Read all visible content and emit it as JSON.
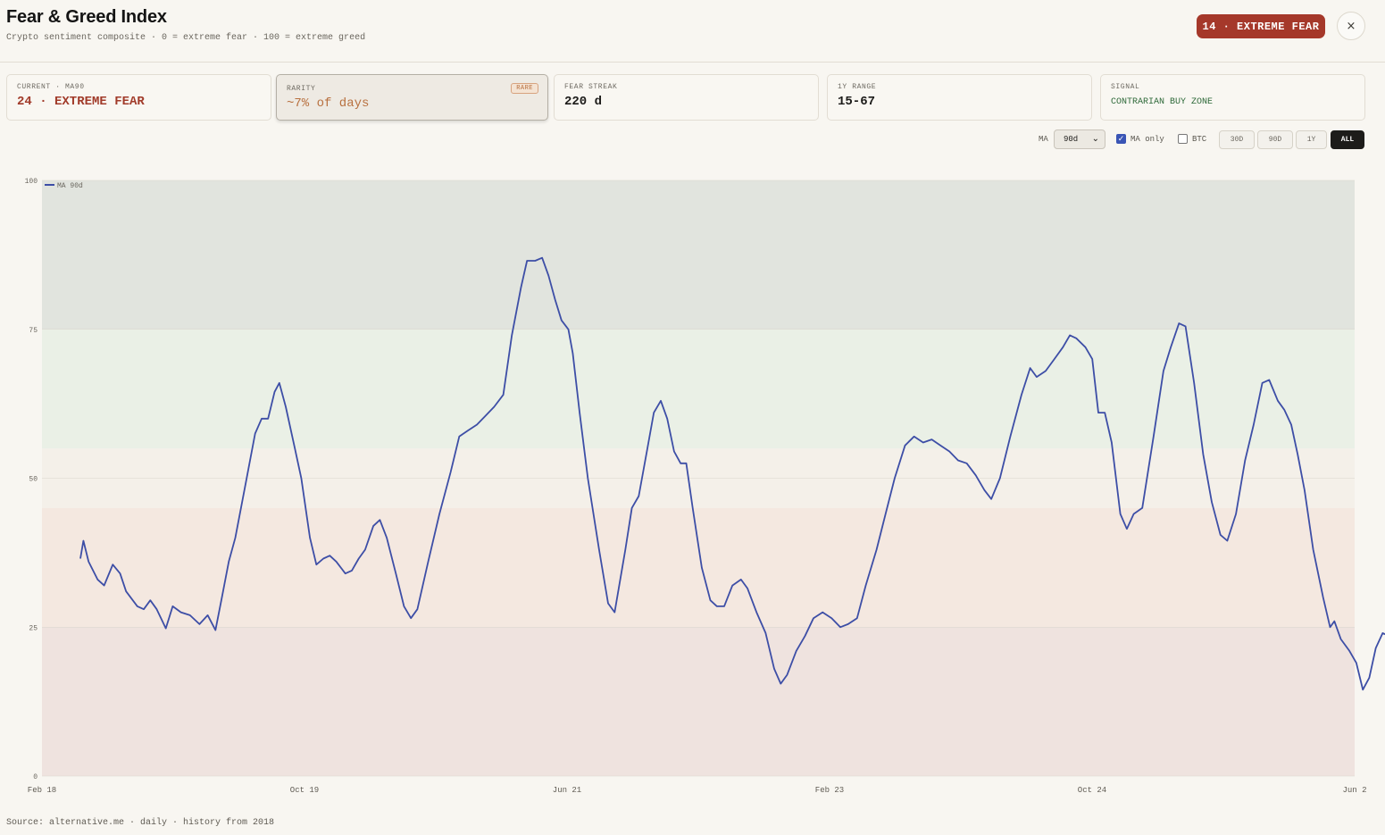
{
  "header": {
    "title": "Fear & Greed Index",
    "subtitle": "Crypto sentiment composite · 0 = extreme fear · 100 = extreme greed",
    "badge": "14 · EXTREME FEAR",
    "close_icon": "close-icon",
    "close_glyph": "×",
    "badge_color": "#a5382a"
  },
  "cards": [
    {
      "label": "CURRENT · MA90",
      "value": "24 · EXTREME FEAR"
    },
    {
      "label": "RARITY",
      "value": "~7% of days",
      "chip": "RARE"
    },
    {
      "label": "FEAR STREAK",
      "value": "220 d"
    },
    {
      "label": "1Y RANGE",
      "value": "15-67"
    },
    {
      "label": "SIGNAL",
      "value": "CONTRARIAN BUY ZONE"
    }
  ],
  "controls": {
    "ma_label": "MA",
    "ma_value": "90d",
    "ma_only_label": "MA only",
    "ma_only_checked": true,
    "btc_label": "BTC",
    "btc_checked": false,
    "ranges": [
      "30D",
      "90D",
      "1Y",
      "ALL"
    ],
    "active_range": "ALL"
  },
  "chart_data": {
    "type": "line",
    "series": [
      {
        "name": "MA 90d",
        "color": "#3d4ea6"
      }
    ],
    "ylim": [
      0,
      100
    ],
    "yticks": [
      "0",
      "25",
      "50",
      "75",
      "100"
    ],
    "xticks": [
      "Feb 18",
      "Oct 19",
      "Jun 21",
      "Feb 23",
      "Oct 24",
      "Jun 2"
    ],
    "xrange": [
      "2018-02",
      "2026-06"
    ],
    "zones": [
      {
        "from": 0,
        "to": 25,
        "color": "#efe3df"
      },
      {
        "from": 25,
        "to": 45,
        "color": "#f4e8e0"
      },
      {
        "from": 45,
        "to": 55,
        "color": "#f4f0e9"
      },
      {
        "from": 55,
        "to": 75,
        "color": "#eaf0e6"
      },
      {
        "from": 75,
        "to": 100,
        "color": "#e1e4de"
      }
    ],
    "points": [
      [
        "2018-05-01",
        36.5
      ],
      [
        "2018-05-08",
        39.5
      ],
      [
        "2018-05-20",
        36
      ],
      [
        "2018-06-10",
        33
      ],
      [
        "2018-06-25",
        32
      ],
      [
        "2018-07-15",
        35.5
      ],
      [
        "2018-08-01",
        34
      ],
      [
        "2018-08-15",
        31
      ],
      [
        "2018-09-10",
        28.5
      ],
      [
        "2018-09-25",
        28
      ],
      [
        "2018-10-10",
        29.5
      ],
      [
        "2018-10-25",
        28
      ],
      [
        "2018-11-15",
        24.8
      ],
      [
        "2018-12-01",
        28.5
      ],
      [
        "2018-12-20",
        27.5
      ],
      [
        "2019-01-10",
        27
      ],
      [
        "2019-02-01",
        25.5
      ],
      [
        "2019-02-20",
        27
      ],
      [
        "2019-03-10",
        24.5
      ],
      [
        "2019-03-25",
        30
      ],
      [
        "2019-04-10",
        36
      ],
      [
        "2019-04-25",
        40
      ],
      [
        "2019-05-20",
        49.5
      ],
      [
        "2019-06-10",
        57.5
      ],
      [
        "2019-06-25",
        60
      ],
      [
        "2019-07-10",
        60
      ],
      [
        "2019-07-25",
        64.5
      ],
      [
        "2019-08-05",
        66
      ],
      [
        "2019-08-20",
        62
      ],
      [
        "2019-09-10",
        55
      ],
      [
        "2019-09-25",
        50
      ],
      [
        "2019-10-15",
        40
      ],
      [
        "2019-10-30",
        35.5
      ],
      [
        "2019-11-15",
        36.5
      ],
      [
        "2019-11-30",
        37
      ],
      [
        "2019-12-15",
        36
      ],
      [
        "2020-01-05",
        34
      ],
      [
        "2020-01-20",
        34.5
      ],
      [
        "2020-02-05",
        36.5
      ],
      [
        "2020-02-20",
        38
      ],
      [
        "2020-03-10",
        42
      ],
      [
        "2020-03-25",
        43
      ],
      [
        "2020-04-10",
        40
      ],
      [
        "2020-05-01",
        34
      ],
      [
        "2020-05-20",
        28.5
      ],
      [
        "2020-06-05",
        26.5
      ],
      [
        "2020-06-20",
        28
      ],
      [
        "2020-07-15",
        36
      ],
      [
        "2020-08-10",
        44
      ],
      [
        "2020-09-05",
        51
      ],
      [
        "2020-09-25",
        57
      ],
      [
        "2020-10-15",
        58
      ],
      [
        "2020-11-05",
        59
      ],
      [
        "2020-11-25",
        60.5
      ],
      [
        "2020-12-15",
        62
      ],
      [
        "2021-01-05",
        64
      ],
      [
        "2021-01-25",
        74
      ],
      [
        "2021-02-15",
        82
      ],
      [
        "2021-03-01",
        86.5
      ],
      [
        "2021-03-20",
        86.5
      ],
      [
        "2021-04-05",
        87
      ],
      [
        "2021-04-20",
        84
      ],
      [
        "2021-05-05",
        80
      ],
      [
        "2021-05-20",
        76.5
      ],
      [
        "2021-06-05",
        75
      ],
      [
        "2021-06-15",
        71
      ],
      [
        "2021-07-01",
        61
      ],
      [
        "2021-07-20",
        50
      ],
      [
        "2021-08-15",
        38
      ],
      [
        "2021-09-05",
        29
      ],
      [
        "2021-09-20",
        27.5
      ],
      [
        "2021-10-15",
        38
      ],
      [
        "2021-10-30",
        45
      ],
      [
        "2021-11-15",
        47
      ],
      [
        "2021-12-05",
        55
      ],
      [
        "2021-12-20",
        61
      ],
      [
        "2022-01-05",
        63
      ],
      [
        "2022-01-20",
        60
      ],
      [
        "2022-02-05",
        54.5
      ],
      [
        "2022-02-20",
        52.5
      ],
      [
        "2022-03-05",
        52.5
      ],
      [
        "2022-03-20",
        45
      ],
      [
        "2022-04-10",
        35
      ],
      [
        "2022-04-30",
        29.5
      ],
      [
        "2022-05-15",
        28.5
      ],
      [
        "2022-06-01",
        28.5
      ],
      [
        "2022-06-20",
        32
      ],
      [
        "2022-07-10",
        33
      ],
      [
        "2022-07-25",
        31.5
      ],
      [
        "2022-08-15",
        27.5
      ],
      [
        "2022-09-05",
        24
      ],
      [
        "2022-09-25",
        18
      ],
      [
        "2022-10-10",
        15.5
      ],
      [
        "2022-10-25",
        17
      ],
      [
        "2022-11-15",
        21
      ],
      [
        "2022-12-05",
        23.5
      ],
      [
        "2022-12-25",
        26.5
      ],
      [
        "2023-01-15",
        27.5
      ],
      [
        "2023-02-05",
        26.5
      ],
      [
        "2023-02-25",
        25
      ],
      [
        "2023-03-15",
        25.5
      ],
      [
        "2023-04-05",
        26.5
      ],
      [
        "2023-04-25",
        32
      ],
      [
        "2023-05-20",
        38
      ],
      [
        "2023-06-10",
        44
      ],
      [
        "2023-07-01",
        50
      ],
      [
        "2023-07-25",
        55.5
      ],
      [
        "2023-08-15",
        57
      ],
      [
        "2023-09-05",
        56
      ],
      [
        "2023-09-25",
        56.5
      ],
      [
        "2023-10-15",
        55.5
      ],
      [
        "2023-11-05",
        54.5
      ],
      [
        "2023-11-25",
        53
      ],
      [
        "2023-12-15",
        52.5
      ],
      [
        "2024-01-05",
        50.5
      ],
      [
        "2024-01-25",
        48
      ],
      [
        "2024-02-10",
        46.5
      ],
      [
        "2024-03-01",
        50
      ],
      [
        "2024-03-25",
        57
      ],
      [
        "2024-04-20",
        64
      ],
      [
        "2024-05-10",
        68.5
      ],
      [
        "2024-05-25",
        67
      ],
      [
        "2024-06-15",
        68
      ],
      [
        "2024-07-05",
        70
      ],
      [
        "2024-07-25",
        72
      ],
      [
        "2024-08-10",
        74
      ],
      [
        "2024-08-25",
        73.5
      ],
      [
        "2024-09-15",
        72
      ],
      [
        "2024-10-01",
        70
      ],
      [
        "2024-10-15",
        61
      ],
      [
        "2024-10-30",
        61
      ],
      [
        "2024-11-15",
        56
      ],
      [
        "2024-12-05",
        44
      ],
      [
        "2024-12-20",
        41.5
      ],
      [
        "2025-01-05",
        44
      ],
      [
        "2025-01-25",
        45
      ],
      [
        "2025-02-20",
        57
      ],
      [
        "2025-03-15",
        68
      ],
      [
        "2025-04-01",
        72
      ],
      [
        "2025-04-20",
        76
      ],
      [
        "2025-05-05",
        75.5
      ],
      [
        "2025-05-25",
        66
      ],
      [
        "2025-06-15",
        54
      ],
      [
        "2025-07-05",
        46
      ],
      [
        "2025-07-25",
        40.5
      ],
      [
        "2025-08-10",
        39.5
      ],
      [
        "2025-08-30",
        44
      ],
      [
        "2025-09-20",
        53
      ],
      [
        "2025-10-10",
        59
      ],
      [
        "2025-10-30",
        66
      ],
      [
        "2025-11-15",
        66.5
      ],
      [
        "2025-12-05",
        63
      ],
      [
        "2025-12-20",
        61.5
      ],
      [
        "2026-01-05",
        59
      ],
      [
        "2026-01-20",
        54
      ],
      [
        "2026-02-05",
        48
      ],
      [
        "2026-02-25",
        38
      ],
      [
        "2026-03-20",
        30
      ],
      [
        "2026-04-05",
        25
      ],
      [
        "2026-04-15",
        26
      ],
      [
        "2026-04-30",
        23
      ],
      [
        "2026-05-20",
        21
      ],
      [
        "2026-06-05",
        19
      ],
      [
        "2026-06-20",
        14.5
      ],
      [
        "2026-07-05",
        16.5
      ],
      [
        "2026-07-20",
        21.5
      ],
      [
        "2026-08-05",
        24
      ],
      [
        "2026-08-20",
        23.5
      ]
    ]
  },
  "footer": "Source: alternative.me · daily · history from 2018"
}
